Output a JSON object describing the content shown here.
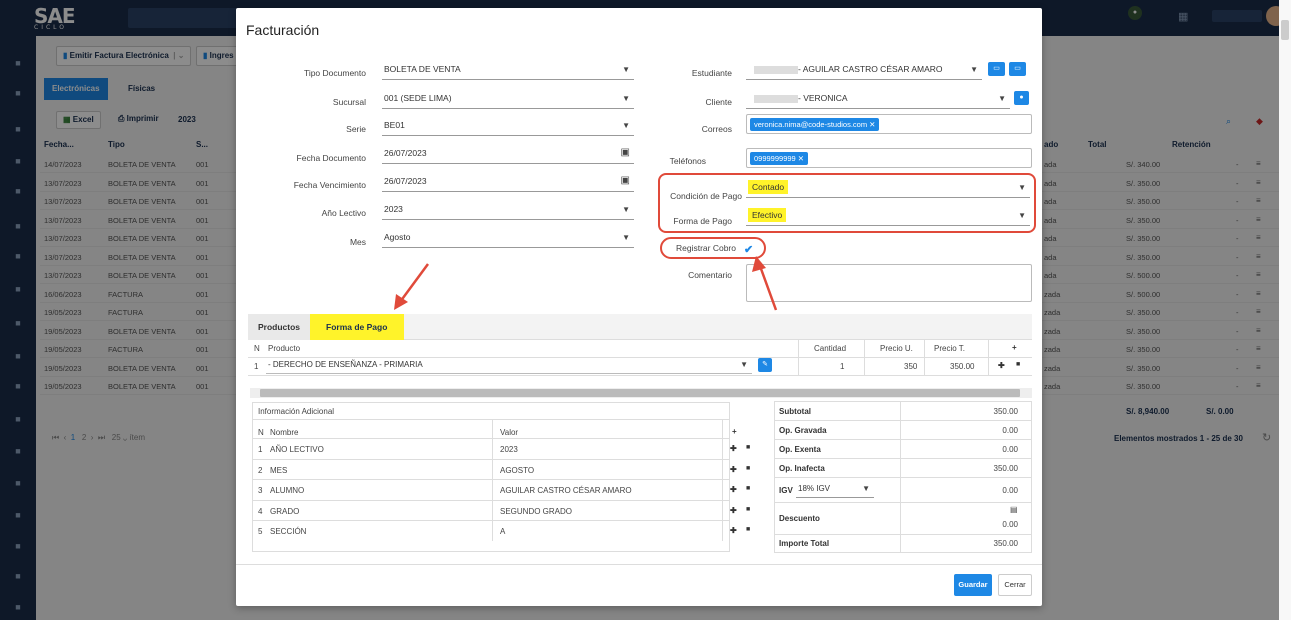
{
  "app": {
    "logo": "SAE",
    "logo_sub": "CICLO"
  },
  "toolbar": {
    "emit_label": "Emitir Factura Electrónica",
    "ingreso_label": "Ingres",
    "excel_label": "Excel",
    "print_label": "Imprimir",
    "year": "2023"
  },
  "tabs_bg": {
    "electronicas": "Electrónicas",
    "fisicas": "Físicas"
  },
  "bg_table": {
    "headers": {
      "fecha": "Fecha...",
      "tipo": "Tipo",
      "serie": "S...",
      "estado": "ado",
      "total": "Total",
      "retencion": "Retención"
    },
    "rows": [
      {
        "fecha": "14/07/2023",
        "tipo": "BOLETA DE VENTA",
        "serie": "001",
        "estado": "ada",
        "total": "S/. 340.00",
        "ret": "-"
      },
      {
        "fecha": "13/07/2023",
        "tipo": "BOLETA DE VENTA",
        "serie": "001",
        "estado": "ada",
        "total": "S/. 350.00",
        "ret": "-"
      },
      {
        "fecha": "13/07/2023",
        "tipo": "BOLETA DE VENTA",
        "serie": "001",
        "estado": "ada",
        "total": "S/. 350.00",
        "ret": "-"
      },
      {
        "fecha": "13/07/2023",
        "tipo": "BOLETA DE VENTA",
        "serie": "001",
        "estado": "ada",
        "total": "S/. 350.00",
        "ret": "-"
      },
      {
        "fecha": "13/07/2023",
        "tipo": "BOLETA DE VENTA",
        "serie": "001",
        "estado": "ada",
        "total": "S/. 350.00",
        "ret": "-"
      },
      {
        "fecha": "13/07/2023",
        "tipo": "BOLETA DE VENTA",
        "serie": "001",
        "estado": "ada",
        "total": "S/. 350.00",
        "ret": "-"
      },
      {
        "fecha": "13/07/2023",
        "tipo": "BOLETA DE VENTA",
        "serie": "001",
        "estado": "ada",
        "total": "S/. 500.00",
        "ret": "-"
      },
      {
        "fecha": "16/06/2023",
        "tipo": "FACTURA",
        "serie": "001",
        "estado": "zada",
        "total": "S/. 500.00",
        "ret": "-"
      },
      {
        "fecha": "19/05/2023",
        "tipo": "FACTURA",
        "serie": "001",
        "estado": "zada",
        "total": "S/. 350.00",
        "ret": "-"
      },
      {
        "fecha": "19/05/2023",
        "tipo": "BOLETA DE VENTA",
        "serie": "001",
        "estado": "zada",
        "total": "S/. 350.00",
        "ret": "-"
      },
      {
        "fecha": "19/05/2023",
        "tipo": "FACTURA",
        "serie": "001",
        "estado": "zada",
        "total": "S/. 350.00",
        "ret": "-"
      },
      {
        "fecha": "19/05/2023",
        "tipo": "BOLETA DE VENTA",
        "serie": "001",
        "estado": "zada",
        "total": "S/. 350.00",
        "ret": "-"
      },
      {
        "fecha": "19/05/2023",
        "tipo": "BOLETA DE VENTA",
        "serie": "001",
        "estado": "zada",
        "total": "S/. 350.00",
        "ret": "-"
      }
    ],
    "sum_total": "S/. 8,940.00",
    "sum_ret": "S/. 0.00",
    "pager": {
      "p1": "1",
      "p2": "2",
      "size": "25",
      "items": "ítem"
    },
    "shown": "Elementos mostrados 1 - 25 de 30"
  },
  "modal": {
    "title": "Facturación",
    "left": {
      "tipo_documento": {
        "label": "Tipo Documento",
        "value": "BOLETA DE VENTA"
      },
      "sucursal": {
        "label": "Sucursal",
        "value": "001 (SEDE LIMA)"
      },
      "serie": {
        "label": "Serie",
        "value": "BE01"
      },
      "fecha_documento": {
        "label": "Fecha Documento",
        "value": "26/07/2023"
      },
      "fecha_vencimiento": {
        "label": "Fecha Vencimiento",
        "value": "26/07/2023"
      },
      "anio_lectivo": {
        "label": "Año Lectivo",
        "value": "2023"
      },
      "mes": {
        "label": "Mes",
        "value": "Agosto"
      }
    },
    "right": {
      "estudiante": {
        "label": "Estudiante",
        "value": "- AGUILAR CASTRO CÉSAR AMARO"
      },
      "cliente": {
        "label": "Cliente",
        "value": "- VERONICA"
      },
      "correos": {
        "label": "Correos",
        "chip": "veronica.nima@code-studios.com"
      },
      "telefonos": {
        "label": "Teléfonos",
        "chip": "0999999999"
      },
      "condicion": {
        "label": "Condición de Pago",
        "value": "Contado"
      },
      "forma": {
        "label": "Forma de Pago",
        "value": "Efectivo"
      },
      "registrar": {
        "label": "Registrar Cobro"
      },
      "comentario": {
        "label": "Comentario"
      }
    },
    "tabs": {
      "productos": "Productos",
      "forma_pago": "Forma de Pago"
    },
    "products": {
      "headers": {
        "n": "N",
        "producto": "Producto",
        "cantidad": "Cantidad",
        "precio_u": "Precio U.",
        "precio_t": "Precio T.",
        "add": "+"
      },
      "rows": [
        {
          "n": "1",
          "producto": "- DERECHO DE ENSEÑANZA - PRIMARIA",
          "cantidad": "1",
          "precio_u": "350",
          "precio_t": "350.00"
        }
      ]
    },
    "info": {
      "title": "Información Adicional",
      "headers": {
        "n": "N",
        "nombre": "Nombre",
        "valor": "Valor",
        "add": "+"
      },
      "rows": [
        {
          "n": "1",
          "nombre": "AÑO LECTIVO",
          "valor": "2023"
        },
        {
          "n": "2",
          "nombre": "MES",
          "valor": "AGOSTO"
        },
        {
          "n": "3",
          "nombre": "ALUMNO",
          "valor": "AGUILAR CASTRO CÉSAR AMARO"
        },
        {
          "n": "4",
          "nombre": "GRADO",
          "valor": "SEGUNDO GRADO"
        },
        {
          "n": "5",
          "nombre": "SECCIÓN",
          "valor": "A"
        }
      ]
    },
    "totals": {
      "subtotal": {
        "label": "Subtotal",
        "value": "350.00"
      },
      "gravada": {
        "label": "Op. Gravada",
        "value": "0.00"
      },
      "exenta": {
        "label": "Op. Exenta",
        "value": "0.00"
      },
      "inafecta": {
        "label": "Op. Inafecta",
        "value": "350.00"
      },
      "igv": {
        "label": "IGV",
        "select": "18% IGV",
        "value": "0.00"
      },
      "descuento": {
        "label": "Descuento",
        "value": "0.00"
      },
      "importe": {
        "label": "Importe Total",
        "value": "350.00"
      }
    },
    "buttons": {
      "guardar": "Guardar",
      "cerrar": "Cerrar"
    }
  },
  "colors": {
    "primary": "#1e88e5",
    "highlight": "#fff32a",
    "annotation": "#e04a3a",
    "navy": "#1a2d4a"
  }
}
